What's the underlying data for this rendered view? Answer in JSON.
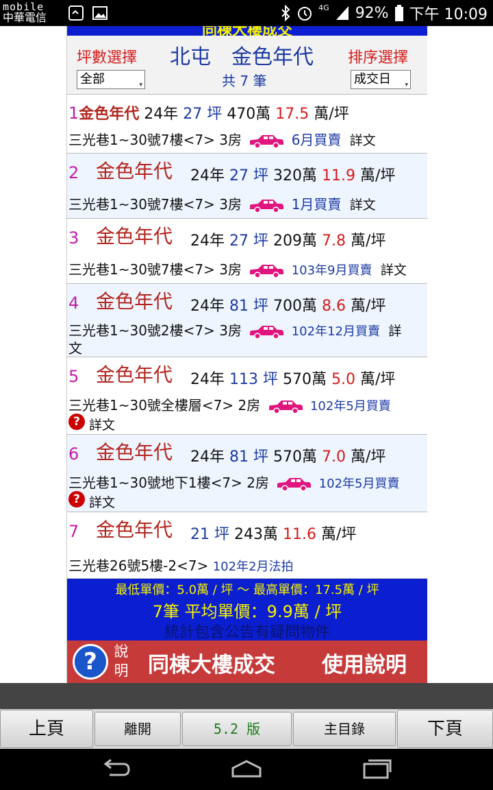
{
  "status_bar": {
    "carrier_brand": "mobile",
    "carrier_name": "中華電信",
    "network": "4G",
    "battery": "92%",
    "time": "下午 10:09",
    "icons": [
      "sim-icon",
      "image-icon",
      "bluetooth-icon",
      "alarm-icon",
      "signal-icon",
      "battery-icon"
    ]
  },
  "header": {
    "area_filter_label": "坪數選擇",
    "title": "北屯　金色年代",
    "sort_label": "排序選擇",
    "area_filter_value": "全部",
    "count_text": "共 7 筆",
    "sort_value": "成交日"
  },
  "listings": [
    {
      "index": "1",
      "name": "金色年代",
      "age": "24年",
      "area": "27 坪",
      "total": "470萬",
      "unit_price": "17.5",
      "unit_suffix": "萬/坪",
      "address": "三光巷1~30號7樓<7> 3房",
      "date": "6月買賣",
      "detail": "詳文"
    },
    {
      "index": "2",
      "name": "金色年代",
      "age": "24年",
      "area": "27 坪",
      "total": "320萬",
      "unit_price": "11.9",
      "unit_suffix": "萬/坪",
      "address": "三光巷1~30號7樓<7> 3房",
      "date": "1月買賣",
      "detail": "詳文"
    },
    {
      "index": "3",
      "name": "金色年代",
      "age": "24年",
      "area": "27 坪",
      "total": "209萬",
      "unit_price": "7.8",
      "unit_suffix": "萬/坪",
      "address": "三光巷1~30號7樓<7> 3房",
      "date": "103年9月買賣",
      "detail": "詳文"
    },
    {
      "index": "4",
      "name": "金色年代",
      "age": "24年",
      "area": "81 坪",
      "total": "700萬",
      "unit_price": "8.6",
      "unit_suffix": "萬/坪",
      "address": "三光巷1~30號2樓<7> 3房",
      "date": "102年12月買賣",
      "detail_a": "詳",
      "detail_b": "文"
    },
    {
      "index": "5",
      "name": "金色年代",
      "age": "24年",
      "area": "113 坪",
      "total": "570萬",
      "unit_price": "5.0",
      "unit_suffix": "萬/坪",
      "address": "三光巷1~30號全樓層<7> 2房",
      "date": "102年5月買賣",
      "detail": "詳文"
    },
    {
      "index": "6",
      "name": "金色年代",
      "age": "24年",
      "area": "81 坪",
      "total": "570萬",
      "unit_price": "7.0",
      "unit_suffix": "萬/坪",
      "address": "三光巷1~30號地下1樓<7> 2房",
      "date": "102年5月買賣",
      "detail": "詳文"
    },
    {
      "index": "7",
      "name": "金色年代",
      "area": "21 坪",
      "total": "243萬",
      "unit_price": "11.6",
      "unit_suffix": "萬/坪",
      "address": "三光巷26號5樓-2<7>",
      "date": "102年2月法拍"
    }
  ],
  "summary": {
    "range": "最低單價：5.0萬 / 坪 ～ 最高單價：17.5萬 / 坪",
    "average": "7筆 平均單價：9.9萬 / 坪",
    "note": "統計包含公告有疑問物件"
  },
  "help_bar": {
    "vertical_1": "說",
    "vertical_2": "明",
    "same_building": "同棟大樓成交",
    "usage": "使用說明"
  },
  "bottom_buttons": {
    "prev": "上頁",
    "exit": "離開",
    "version": "5.2 版",
    "menu": "主目錄",
    "next": "下頁"
  },
  "colors": {
    "accent_blue": "#0b1fd0",
    "price_red": "#d41b1b",
    "index_magenta": "#c21ca8",
    "car_pink": "#e0157e",
    "help_red": "#c73a3a"
  }
}
